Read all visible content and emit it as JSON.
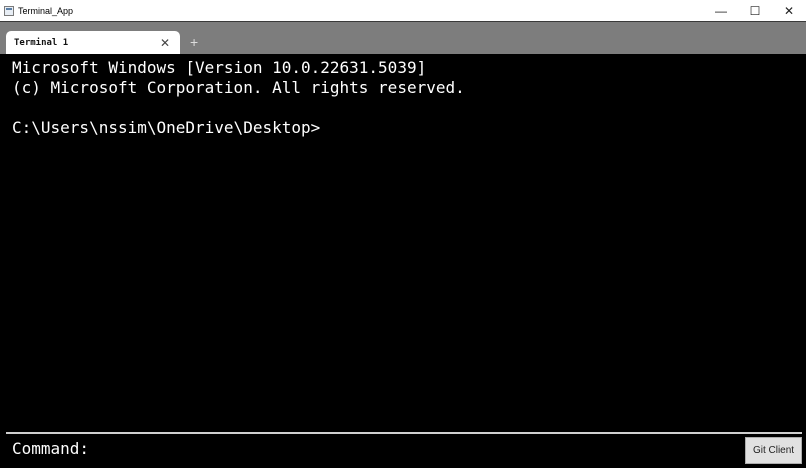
{
  "window": {
    "title": "Terminal_App",
    "minimize_glyph": "—",
    "maximize_glyph": "☐",
    "close_glyph": "✕"
  },
  "tabs": [
    {
      "label": "Terminal 1",
      "close_glyph": "✕",
      "active": true
    }
  ],
  "new_tab_glyph": "+",
  "terminal": {
    "lines": [
      "Microsoft Windows [Version 10.0.22631.5039]",
      "(c) Microsoft Corporation. All rights reserved.",
      "",
      "C:\\Users\\nssim\\OneDrive\\Desktop>"
    ]
  },
  "command_bar": {
    "label": "Command:",
    "value": "",
    "git_button_label": "Git Client"
  },
  "colors": {
    "terminal_bg": "#000000",
    "terminal_fg": "#ffffff",
    "tabbar_bg": "#7d7d7d"
  }
}
